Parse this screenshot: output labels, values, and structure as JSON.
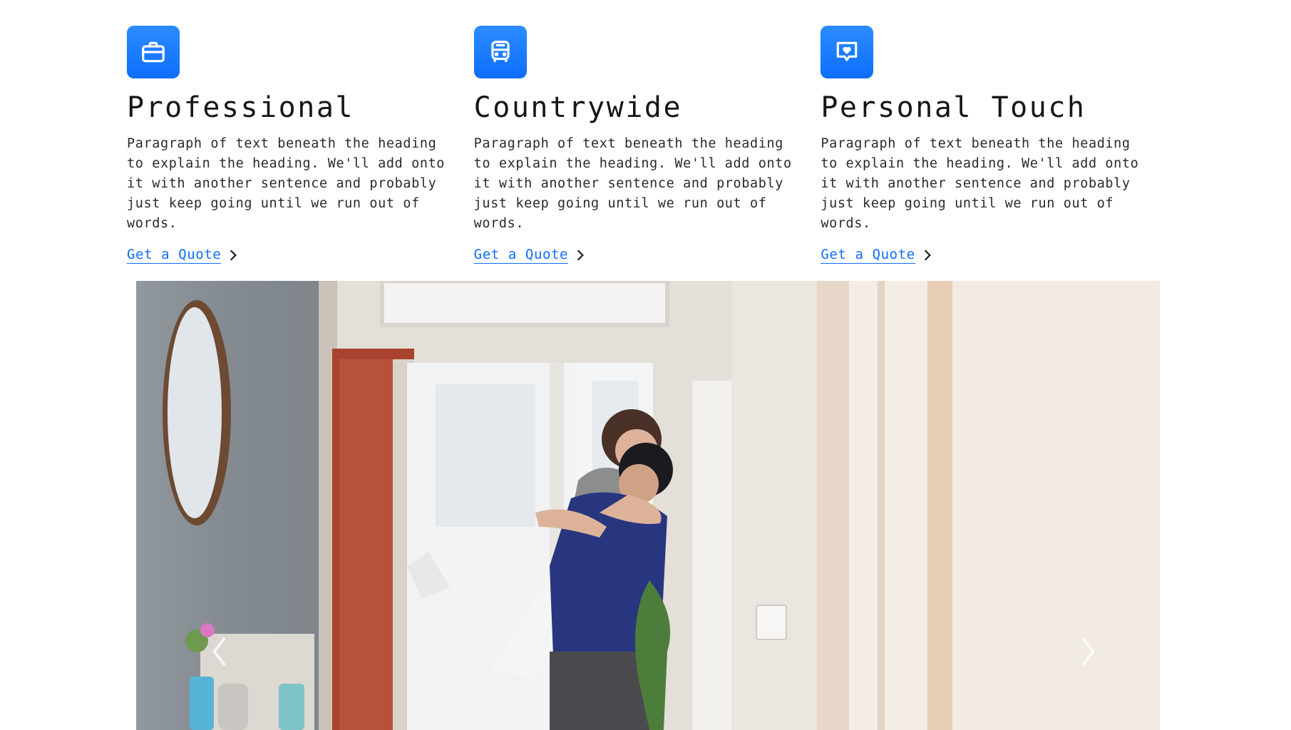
{
  "features": [
    {
      "icon": "briefcase-icon",
      "title": "Professional",
      "text": "Paragraph of text beneath the heading to explain the heading. We'll add onto it with another sentence and probably just keep going until we run out of words.",
      "link": "Get a Quote"
    },
    {
      "icon": "bus-icon",
      "title": "Countrywide",
      "text": "Paragraph of text beneath the heading to explain the heading. We'll add onto it with another sentence and probably just keep going until we run out of words.",
      "link": "Get a Quote"
    },
    {
      "icon": "heart-chat-icon",
      "title": "Personal Touch",
      "text": "Paragraph of text beneath the heading to explain the heading. We'll add onto it with another sentence and probably just keep going until we run out of words.",
      "link": "Get a Quote"
    }
  ],
  "colors": {
    "accent": "#0d6efd",
    "text": "#1f1f1f"
  },
  "carousel": {
    "image": "couple-embracing-in-home-entryway",
    "prev_icon": "chevron-left-icon",
    "next_icon": "chevron-right-icon"
  }
}
